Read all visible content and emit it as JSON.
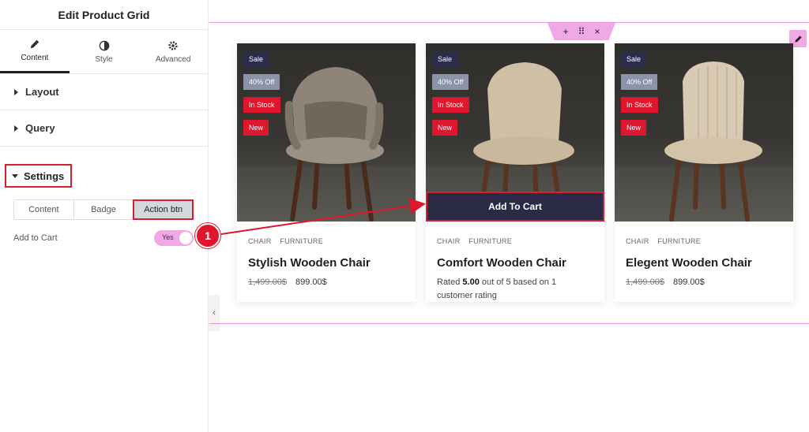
{
  "panel": {
    "title": "Edit Product Grid",
    "tabs": [
      {
        "label": "Content",
        "icon": "pencil-icon"
      },
      {
        "label": "Style",
        "icon": "half-circle-icon"
      },
      {
        "label": "Advanced",
        "icon": "gear-icon"
      }
    ],
    "sections": {
      "layout": "Layout",
      "query": "Query",
      "settings": "Settings"
    },
    "segmented": [
      "Content",
      "Badge",
      "Action btn"
    ],
    "add_to_cart_label": "Add to Cart",
    "toggle_value": "Yes"
  },
  "canvas": {
    "section_tools": {
      "add": "+",
      "move": "⠿",
      "close": "×"
    }
  },
  "cards": [
    {
      "badges": [
        "Sale",
        "40% Off",
        "In Stock",
        "New"
      ],
      "categories": [
        "CHAIR",
        "FURNITURE"
      ],
      "name": "Stylish Wooden Chair",
      "old_price": "1,499.00$",
      "price": "899.00$"
    },
    {
      "badges": [
        "Sale",
        "40% Off",
        "In Stock",
        "New"
      ],
      "button": "Add To Cart",
      "categories": [
        "CHAIR",
        "FURNITURE"
      ],
      "name": "Comfort Wooden Chair",
      "rating_prefix": "Rated ",
      "rating_value": "5.00",
      "rating_suffix": " out of 5 based on 1 customer rating"
    },
    {
      "badges": [
        "Sale",
        "40% Off",
        "In Stock",
        "New"
      ],
      "categories": [
        "CHAIR",
        "FURNITURE"
      ],
      "name": "Elegent Wooden Chair",
      "old_price": "1,499.00$",
      "price": "899.00$"
    }
  ],
  "annotation": {
    "number": "1"
  },
  "colors": {
    "accent_pink": "#f0a8e6",
    "highlight_red": "#d6202f",
    "cart_bg": "#2a2a47"
  }
}
